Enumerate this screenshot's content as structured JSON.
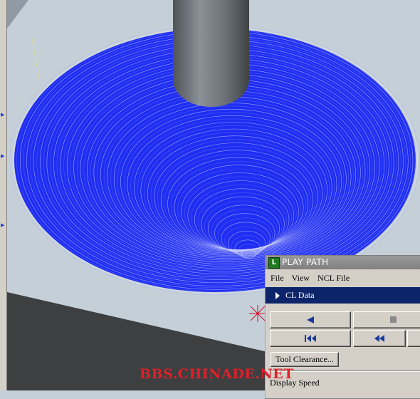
{
  "panel": {
    "title": "PLAY PATH",
    "menu": [
      "File",
      "View",
      "NCL File"
    ],
    "cl_label": "CL Data",
    "buttons": {
      "play_back_icon": "play-reverse-icon",
      "stop_icon": "stop-icon",
      "rewind_start_icon": "rewind-to-start-icon",
      "step_back_icon": "step-back-icon"
    },
    "tool_clearance": "Tool Clearance...",
    "speed_label": "Display Speed"
  },
  "watermark": "BBS.CHINADE.NET",
  "colors": {
    "toolpath": "#1f2ef2",
    "tool": "#6e757b",
    "background": "#c5cfd8",
    "title_bar": "#808080",
    "selection": "#0c246a",
    "button_icon": "#1a3a9a",
    "watermark": "#e0202a"
  }
}
